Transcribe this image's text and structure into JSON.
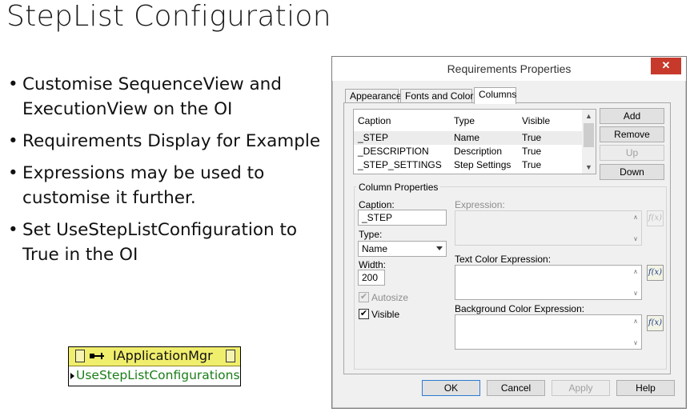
{
  "slide": {
    "title": "StepList Configuration",
    "bullets": [
      "Customise SequenceView and ExecutionView on the OI",
      "Requirements Display for Example",
      "Expressions may be used to customise it further.",
      "Set UseStepListConfiguration to True in the OI"
    ]
  },
  "property_node": {
    "class_name": "IApplicationMgr",
    "property": "UseStepListConfigurations",
    "ref_glyph": "ɑ",
    "colors": {
      "header": "#f0ee6d",
      "property_text": "#1a7d18"
    }
  },
  "dialog": {
    "title": "Requirements Properties",
    "close_glyph": "✕",
    "tabs": [
      "Appearance",
      "Fonts and Colors",
      "Columns"
    ],
    "active_tab": "Columns",
    "list": {
      "headers": [
        "Caption",
        "Type",
        "Visible"
      ],
      "rows": [
        {
          "caption": "_STEP",
          "type": "Name",
          "visible": "True"
        },
        {
          "caption": "_DESCRIPTION",
          "type": "Description",
          "visible": "True"
        },
        {
          "caption": "_STEP_SETTINGS",
          "type": "Step Settings",
          "visible": "True"
        }
      ]
    },
    "side_buttons": {
      "add": "Add",
      "remove": "Remove",
      "up": "Up",
      "down": "Down"
    },
    "column_properties": {
      "group_label": "Column Properties",
      "caption_label": "Caption:",
      "caption_value": "_STEP",
      "type_label": "Type:",
      "type_value": "Name",
      "width_label": "Width:",
      "width_value": "200",
      "autosize_label": "Autosize",
      "visible_label": "Visible",
      "expression_label": "Expression:",
      "text_color_expression_label": "Text Color Expression:",
      "background_color_expression_label": "Background Color Expression:",
      "fx_label": "f(x)"
    },
    "footer_buttons": {
      "ok": "OK",
      "cancel": "Cancel",
      "apply": "Apply",
      "help": "Help"
    }
  }
}
